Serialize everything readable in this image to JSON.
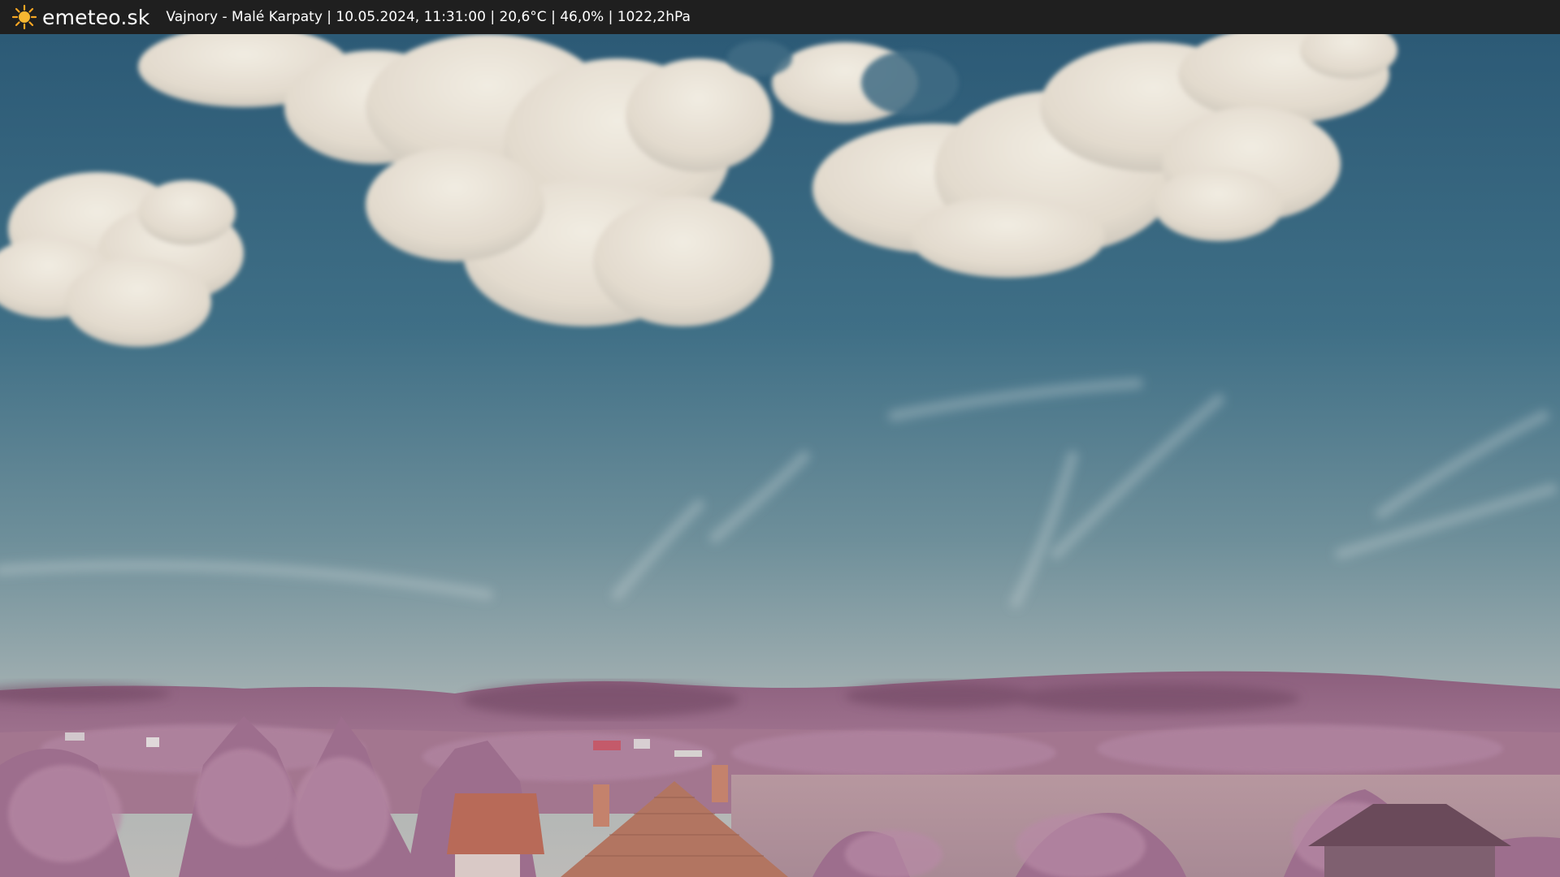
{
  "header": {
    "logo_text": "emeteo.sk",
    "caption": "Vajnory - Malé Karpaty | 10.05.2024, 11:31:00 | 20,6°C | 46,0% | 1022,2hPa",
    "logo_icon": "sun-icon"
  },
  "colors": {
    "bar": "#1f1f1f",
    "sky_top": "#2f5f7a",
    "sky_horizon": "#b4b9b8",
    "cloud": "#eae4d8",
    "hills": "#8a5a78",
    "trees": "#9a6a8c",
    "roof": "#b86a58"
  }
}
